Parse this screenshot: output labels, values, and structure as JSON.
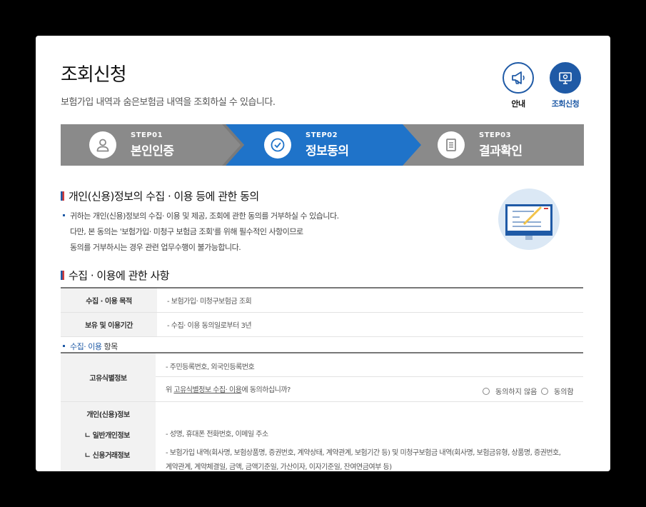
{
  "page": {
    "title": "조회신청",
    "subtitle": "보험가입 내역과 숨은보험금 내역을 조회하실 수 있습니다."
  },
  "quick_buttons": [
    {
      "label": "안내",
      "icon": "megaphone-icon"
    },
    {
      "label": "조회신청",
      "icon": "monitor-icon"
    }
  ],
  "steps": [
    {
      "number": "STEP01",
      "name": "본인인증",
      "icon": "person-icon",
      "active": false
    },
    {
      "number": "STEP02",
      "name": "정보동의",
      "icon": "check-circle-icon",
      "active": true
    },
    {
      "number": "STEP03",
      "name": "결과확인",
      "icon": "document-icon",
      "active": false
    }
  ],
  "consent": {
    "heading": "개인(신용)정보의 수집 · 이용 등에 관한 동의",
    "lines": [
      "귀하는 개인(신용)정보의 수집· 이용 및 제공, 조회에 관한 동의를 거부하실 수 있습니다.",
      "다만, 본 동의는 '보험가입· 미청구 보험금 조회'를 위해 필수적인 사항이므로",
      "동의를 거부하시는 경우 관련 업무수행이 불가능합니다."
    ]
  },
  "usage": {
    "heading": "수집 · 이용에 관한 사항",
    "rows": [
      {
        "label": "수집 · 이용 목적",
        "value": "- 보험가입· 미청구보험금 조회"
      },
      {
        "label": "보유 및 이용기간",
        "value": "- 수집· 이용 동의일로부터 3년"
      }
    ]
  },
  "items": {
    "heading_prefix": "수집· 이용",
    "heading_suffix": " 항목",
    "unique": {
      "label": "고유식별정보",
      "value": "- 주민등록번호, 외국인등록번호",
      "question_pre": "위 ",
      "question_link": "고유식별정보 수집· 이용",
      "question_post": "에 동의하십니까?",
      "option_disagree": "동의하지 않음",
      "option_agree": "동의함"
    },
    "personal": {
      "label": "개인(신용)정보",
      "general_label": "ㄴ  일반개인정보",
      "general_value": "- 성명, 휴대폰 전화번호, 이메일 주소",
      "credit_label": "ㄴ  신용거래정보",
      "credit_value_1": "- 보험가입 내역(회사명, 보험상품명, 증권번호, 계약상태, 계약관계, 보험기간 등) 및 미청구보험금 내역(회사명, 보험금유형, 상품명, 증권번호,",
      "credit_value_2": "계약관계, 계약체결일, 금액, 금액기준일, 가산이자, 이자기준일, 잔여연금여부 등)"
    }
  },
  "colors": {
    "accent": "#1f5aa6",
    "step_active": "#1f73c9",
    "step_inactive": "#8a8a8a",
    "flag_red": "#d23b3b"
  }
}
